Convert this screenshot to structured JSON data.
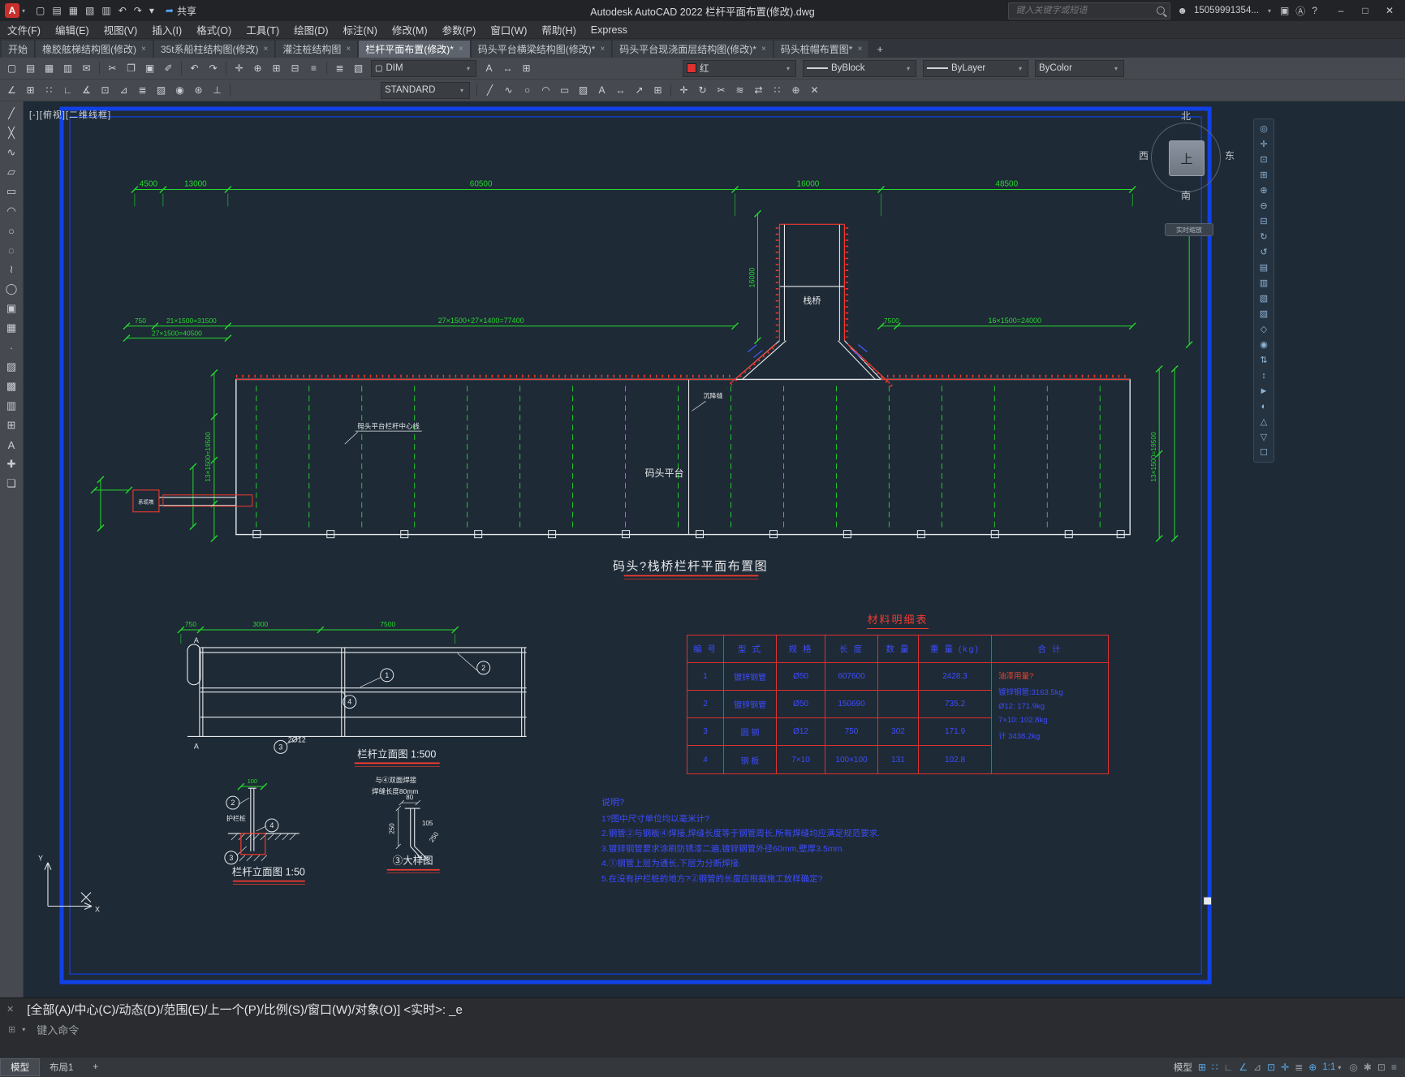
{
  "ui": {
    "caret": "▾",
    "close_glyph": "×",
    "plus": "+"
  },
  "titlebar": {
    "logo_letter": "A",
    "qat_icons": [
      {
        "name": "new",
        "g": "▢"
      },
      {
        "name": "open",
        "g": "▤"
      },
      {
        "name": "save",
        "g": "▦"
      },
      {
        "name": "save-as",
        "g": "▧"
      },
      {
        "name": "plot",
        "g": "▥"
      },
      {
        "name": "undo",
        "g": "↶"
      },
      {
        "name": "redo",
        "g": "↷"
      },
      {
        "name": "customize-quick-access",
        "g": "▾"
      }
    ],
    "share": {
      "label": "共享",
      "g": "➦"
    },
    "app_title": "Autodesk AutoCAD 2022   栏杆平面布置(修改).dwg",
    "search_placeholder": "键入关键字或短语",
    "account": "15059991354...",
    "person_glyph": "☻",
    "cart_glyph": "▣",
    "app_store_glyph": "Ⓐ",
    "help_glyph": "?",
    "window": {
      "minimize": "–",
      "maximize": "□",
      "close": "✕"
    }
  },
  "menubar": {
    "items": [
      "文件(F)",
      "编辑(E)",
      "视图(V)",
      "插入(I)",
      "格式(O)",
      "工具(T)",
      "绘图(D)",
      "标注(N)",
      "修改(M)",
      "参数(P)",
      "窗口(W)",
      "帮助(H)",
      "Express"
    ]
  },
  "tabsbar": {
    "tabs": [
      {
        "label": "开始"
      },
      {
        "label": "橡胶舷梯结构图(修改)"
      },
      {
        "label": "35t系船柱结构图(修改)"
      },
      {
        "label": "灌注桩结构图"
      },
      {
        "label": "栏杆平面布置(修改)*"
      },
      {
        "label": "码头平台横梁结构图(修改)*"
      },
      {
        "label": "码头平台现浇面层结构图(修改)*"
      },
      {
        "label": "码头桩帽布置图*"
      }
    ]
  },
  "toolbar_props": {
    "icons": [
      {
        "name": "qnew",
        "g": "▢"
      },
      {
        "name": "open",
        "g": "▤"
      },
      {
        "name": "save",
        "g": "▦"
      },
      {
        "name": "plot",
        "g": "▥"
      },
      {
        "name": "publish",
        "g": "✉"
      },
      {
        "name": "cut",
        "g": "✂"
      },
      {
        "name": "copy",
        "g": "❐"
      },
      {
        "name": "paste",
        "g": "▣"
      },
      {
        "name": "match-properties",
        "g": "✐"
      },
      {
        "name": "undo",
        "g": "↶"
      },
      {
        "name": "redo",
        "g": "↷"
      },
      {
        "name": "pan",
        "g": "✛"
      },
      {
        "name": "zoom-realtime",
        "g": "⊕"
      },
      {
        "name": "zoom-window",
        "g": "⊞"
      },
      {
        "name": "zoom-previous",
        "g": "⊟"
      },
      {
        "name": "properties-palette",
        "g": "≡"
      }
    ],
    "layer_icons": [
      {
        "name": "layer-properties",
        "g": "≣"
      },
      {
        "name": "layer-states",
        "g": "▧"
      }
    ],
    "layer_combo": {
      "swatch_glyph": "▢",
      "value": "DIM"
    },
    "mid_icons": [
      {
        "name": "text-style",
        "g": "A"
      },
      {
        "name": "dim-style",
        "g": "↔"
      },
      {
        "name": "table-style",
        "g": "⊞"
      }
    ],
    "color_combo": {
      "label": "红",
      "hex": "#e03030"
    },
    "linetype_combo": "ByBlock",
    "lineweight_combo": "ByLayer",
    "plotstyle_combo": "ByColor"
  },
  "toolbar_draw": {
    "left_icons": [
      {
        "name": "infer-constraints",
        "g": "∠"
      },
      {
        "name": "snap-mode",
        "g": "⊞"
      },
      {
        "name": "grid-display",
        "g": "∷"
      },
      {
        "name": "ortho-mode",
        "g": "∟"
      },
      {
        "name": "polar-tracking",
        "g": "∡"
      },
      {
        "name": "object-snap",
        "g": "⊡"
      },
      {
        "name": "object-snap-tracking",
        "g": "⊿"
      },
      {
        "name": "lineweight-display",
        "g": "≣"
      },
      {
        "name": "transparency",
        "g": "▨"
      },
      {
        "name": "selection-cycling",
        "g": "◉"
      },
      {
        "name": "3d-object-snap",
        "g": "⊛"
      },
      {
        "name": "dynamic-ucs",
        "g": "⊥"
      }
    ],
    "style_combo": "STANDARD",
    "right_icons": [
      {
        "name": "line",
        "g": "╱"
      },
      {
        "name": "polyline",
        "g": "∿"
      },
      {
        "name": "circle",
        "g": "○"
      },
      {
        "name": "arc",
        "g": "◠"
      },
      {
        "name": "rectangle",
        "g": "▭"
      },
      {
        "name": "hatch",
        "g": "▨"
      },
      {
        "name": "text",
        "g": "A"
      },
      {
        "name": "dimension",
        "g": "↔"
      },
      {
        "name": "leader",
        "g": "↗"
      },
      {
        "name": "table",
        "g": "⊞"
      },
      {
        "name": "move",
        "g": "✛"
      },
      {
        "name": "rotate",
        "g": "↻"
      },
      {
        "name": "trim",
        "g": "✂"
      },
      {
        "name": "offset",
        "g": "≋"
      },
      {
        "name": "mirror",
        "g": "⇄"
      },
      {
        "name": "array",
        "g": "∷"
      },
      {
        "name": "scale",
        "g": "⊕"
      },
      {
        "name": "erase",
        "g": "✕"
      }
    ]
  },
  "left_toolbar": {
    "tools": [
      {
        "name": "line",
        "g": "╱"
      },
      {
        "name": "construction-line",
        "g": "╳"
      },
      {
        "name": "polyline",
        "g": "∿"
      },
      {
        "name": "polygon",
        "g": "▱"
      },
      {
        "name": "rectangle",
        "g": "▭"
      },
      {
        "name": "arc",
        "g": "◠"
      },
      {
        "name": "circle",
        "g": "○"
      },
      {
        "name": "revision-cloud",
        "g": "◌"
      },
      {
        "name": "spline",
        "g": "≀"
      },
      {
        "name": "ellipse",
        "g": "◯"
      },
      {
        "name": "insert-block",
        "g": "▣"
      },
      {
        "name": "create-block",
        "g": "▦"
      },
      {
        "name": "point",
        "g": "∙"
      },
      {
        "name": "hatch",
        "g": "▨"
      },
      {
        "name": "gradient",
        "g": "▩"
      },
      {
        "name": "region",
        "g": "▥"
      },
      {
        "name": "table",
        "g": "⊞"
      },
      {
        "name": "multiline-text",
        "g": "A"
      },
      {
        "name": "add-selected",
        "g": "✚"
      },
      {
        "name": "group",
        "g": "❏"
      }
    ]
  },
  "nav_toolbar": {
    "tools": [
      {
        "name": "navigation-wheel",
        "g": "◎"
      },
      {
        "name": "pan",
        "g": "✛"
      },
      {
        "name": "zoom-extents",
        "g": "⊡"
      },
      {
        "name": "zoom-window",
        "g": "⊞"
      },
      {
        "name": "zoom-in",
        "g": "⊕"
      },
      {
        "name": "zoom-out",
        "g": "⊖"
      },
      {
        "name": "zoom-previous",
        "g": "⊟"
      },
      {
        "name": "orbit",
        "g": "↻"
      },
      {
        "name": "free-orbit",
        "g": "↺"
      },
      {
        "name": "top-view",
        "g": "▤"
      },
      {
        "name": "front-view",
        "g": "▥"
      },
      {
        "name": "left-view",
        "g": "▧"
      },
      {
        "name": "right-view",
        "g": "▨"
      },
      {
        "name": "iso-view",
        "g": "◇"
      },
      {
        "name": "camera",
        "g": "◉"
      },
      {
        "name": "walk",
        "g": "⇅"
      },
      {
        "name": "fly",
        "g": "↕"
      },
      {
        "name": "show-motion",
        "g": "►"
      },
      {
        "name": "steering-wheel",
        "g": "◐"
      },
      {
        "name": "3d-views",
        "g": "△"
      },
      {
        "name": "visual-styles",
        "g": "▽"
      },
      {
        "name": "named-views",
        "g": "☐"
      }
    ]
  },
  "viewcube": {
    "north": "北",
    "south": "南",
    "west": "西",
    "east": "东",
    "top": "上",
    "tooltip": "实时缩放"
  },
  "canvas": {
    "viewport_controls": "[-][俯视][二维线框]"
  },
  "drawing": {
    "dims_top": [
      "4500",
      "13000",
      "60500",
      "16000",
      "48500"
    ],
    "dims_mid": [
      "750",
      "21×1500=31500",
      "27×1500+27×1400=77400",
      "7500",
      "16×1500=24000"
    ],
    "dim_mid_left2": "27×1500=40500",
    "dim_trestle": "16000",
    "dim_left_rot": "13×1500=19500",
    "dim_right_rot": "13×1500=19500",
    "labels": {
      "trestle": "栈桥",
      "platform": "码头平台",
      "centerline": "码头平台栏杆中心线",
      "joint": "沉降缝",
      "dolphin": "系缆墩"
    },
    "plan_title": "码头?栈桥栏杆平面布置图",
    "elev500": {
      "dims": [
        "750",
        "3000",
        "7500"
      ],
      "section_marker": "A",
      "bubble1": "1",
      "bubble2": "2",
      "bubble3": "3",
      "bubble4": "4",
      "rebar_label": "2Ø12",
      "title": "栏杆立面图 1:500"
    },
    "elev50": {
      "dim": "100",
      "post_label": "护栏桩",
      "bubble2": "2",
      "bubble3": "3",
      "bubble4": "4",
      "title": "栏杆立面图 1:50"
    },
    "detail": {
      "weld_note1": "与④双面焊接",
      "weld_note2": "焊缝长度80mm",
      "dim_80": "80",
      "dim_250_left": "250",
      "dim_105": "105",
      "dim_250_right": "250",
      "title": "③大样图"
    }
  },
  "material_table": {
    "title": "材料明细表",
    "headers": [
      "编 号",
      "型 式",
      "规 格",
      "长 度",
      "数 量",
      "重 量 (kg)",
      "合 计"
    ],
    "rows": [
      [
        "1",
        "镀锌钢管",
        "Ø50",
        "607600",
        "",
        "2428.3"
      ],
      [
        "2",
        "镀锌钢管",
        "Ø50",
        "150690",
        "",
        "735.2"
      ],
      [
        "3",
        "圆 钢",
        "Ø12",
        "750",
        "302",
        "171.9"
      ],
      [
        "4",
        "钢 板",
        "7×10",
        "100×100",
        "131",
        "102.8"
      ]
    ],
    "summary": [
      "油漆用量?",
      "镀锌钢管:3163.5kg",
      "Ø12: 171.9kg",
      "7×10: 102.8kg",
      "计 3438.2kg"
    ]
  },
  "notes": {
    "title": "说明?",
    "lines": [
      "1?图中尺寸单位均以毫米计?",
      "2.钢管②与钢板④焊接,焊缝长度等于钢管周长,所有焊缝均应满足规范要求.",
      "3.镀锌钢管要求涂刷防锈漆二遍,镀锌钢管外径60mm,壁厚3.5mm.",
      "4.①钢管上层为通长,下层为分断焊接.",
      "5.在没有护栏桩的地方?②钢管的长度应根据施工放样确定?"
    ]
  },
  "command": {
    "close_glyph": "✕",
    "history": "[全部(A)/中心(C)/动态(D)/范围(E)/上一个(P)/比例(S)/窗口(W)/对象(O)] <实时>: _e",
    "input_icon_glyph": "⊞",
    "prompt": "键入命令"
  },
  "bottombar": {
    "model_tab": "模型",
    "layout_tab": "布局1",
    "model_label": "模型",
    "toggles": [
      {
        "name": "grid-display",
        "g": "⊞"
      },
      {
        "name": "snap-mode",
        "g": "∷"
      },
      {
        "name": "ortho-mode",
        "g": "∟"
      },
      {
        "name": "polar-tracking",
        "g": "∠"
      },
      {
        "name": "isometric-drafting",
        "g": "⊿"
      },
      {
        "name": "object-snap",
        "g": "⊡"
      },
      {
        "name": "object-snap-tracking",
        "g": "✛"
      },
      {
        "name": "lineweight-display",
        "g": "≣"
      },
      {
        "name": "dynamic-input",
        "g": "⊕"
      }
    ],
    "scale": "1:1",
    "trailing": [
      {
        "name": "isolate-objects",
        "g": "◎"
      },
      {
        "name": "hardware-acceleration",
        "g": "✱"
      },
      {
        "name": "clean-screen",
        "g": "⊡"
      },
      {
        "name": "customization-menu",
        "g": "≡"
      }
    ]
  }
}
